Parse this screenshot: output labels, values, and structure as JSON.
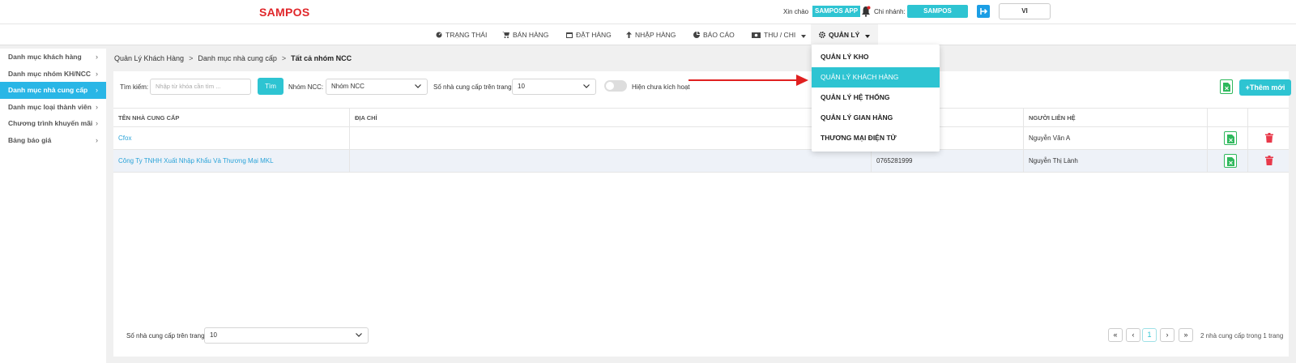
{
  "header": {
    "logo": "SAMPOS",
    "greeting": "Xin chào",
    "user_badge": "SAMPOS APP",
    "branch_label": "Chi nhánh:",
    "branch_value": "SAMPOS",
    "language": "VI"
  },
  "nav": {
    "items": [
      "TRẠNG THÁI",
      "BÁN HÀNG",
      "ĐẶT HÀNG",
      "NHẬP HÀNG",
      "BÁO CÁO",
      "THU / CHI",
      "QUẢN LÝ"
    ],
    "active": "QUẢN LÝ"
  },
  "dropdown": {
    "items": [
      "QUẢN LÝ KHO",
      "QUẢN LÝ KHÁCH HÀNG",
      "QUẢN LÝ HỆ THỐNG",
      "QUẢN LÝ GIAN HÀNG",
      "THƯƠNG MẠI ĐIỆN TỬ"
    ],
    "highlighted": "QUẢN LÝ KHÁCH HÀNG"
  },
  "sidebar": {
    "items": [
      "Danh mục khách hàng",
      "Danh mục nhóm KH/NCC",
      "Danh mục nhà cung cấp",
      "Danh mục loại thành viên",
      "Chương trình khuyến mãi",
      "Bảng báo giá"
    ],
    "active": "Danh mục nhà cung cấp"
  },
  "breadcrumb": {
    "items": [
      "Quản Lý Khách Hàng",
      "Danh mục nhà cung cấp"
    ],
    "current": "Tất cả nhóm NCC",
    "separator": ">"
  },
  "filters": {
    "search_label": "Tìm kiếm:",
    "search_placeholder": "Nhập từ khóa cần tìm ...",
    "search_button": "Tìm",
    "group_label": "Nhóm NCC:",
    "group_value": "Nhóm NCC",
    "per_page_label": "Số nhà cung cấp trên trang:",
    "per_page_value": "10",
    "toggle_label": "Hiện chưa kích hoạt",
    "add_button": "+Thêm mới"
  },
  "table": {
    "columns": [
      "TÊN NHÀ CUNG CẤP",
      "ĐỊA CHỈ",
      "",
      "NGƯỜI LIÊN HỆ"
    ],
    "rows": [
      {
        "name": "Cfox",
        "address": "",
        "phone": "",
        "contact": "Nguyễn Văn A"
      },
      {
        "name": "Công Ty TNHH Xuất Nhập Khẩu Và Thương Mại MKL",
        "address": "",
        "phone": "0765281999",
        "contact": "Nguyễn Thị Lành"
      }
    ]
  },
  "footer": {
    "per_page_label": "Số nhà cung cấp trên trang:",
    "per_page_value": "10",
    "pager": {
      "first": "«",
      "prev": "‹",
      "current": "1",
      "next": "›",
      "last": "»"
    },
    "info": "2 nhà cung cấp trong 1 trang"
  },
  "colors": {
    "brand": "#e0262a",
    "accent": "#2ec4d2",
    "sidebar_active": "#29b6e6",
    "excel": "#2eb85c",
    "delete": "#e8394a",
    "annotation_arrow": "#e02020"
  }
}
